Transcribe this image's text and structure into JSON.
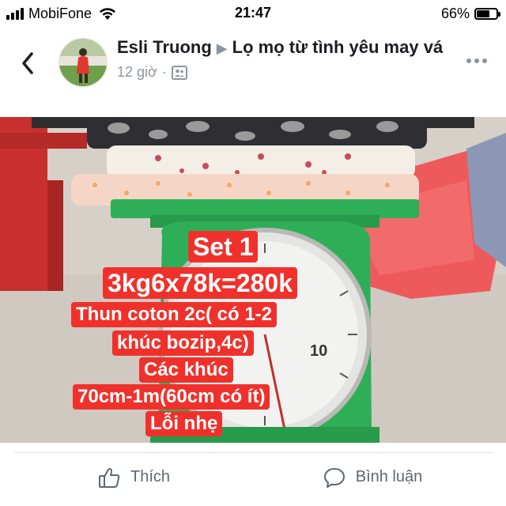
{
  "status_bar": {
    "carrier": "MobiFone",
    "time": "21:47",
    "battery_percent": "66%",
    "battery_level": 0.66,
    "icons": [
      "signal-icon",
      "wifi-icon",
      "battery-icon"
    ]
  },
  "post": {
    "author": "Esli Truong",
    "separator": "▶",
    "group": "Lọ mọ từ tình yêu may vá",
    "timestamp": "12 giờ",
    "meta_dot": "·",
    "audience_icon": "group-audience-icon",
    "image_text": {
      "line1": "Set 1",
      "line2": "3kg6x78k=280k",
      "line3": "Thun coton 2c( có 1-2",
      "line4": "khúc bozip,4c)",
      "line5": "Các khúc",
      "line6": "70cm-1m(60cm có ít)",
      "line7": "Lỗi nhẹ"
    },
    "scale_dial_number": "10"
  },
  "actions": {
    "like_label": "Thích",
    "comment_label": "Bình luận"
  },
  "colors": {
    "overlay_red": "#f0312b",
    "scale_green": "#2fae58",
    "text_gray": "#606770"
  }
}
